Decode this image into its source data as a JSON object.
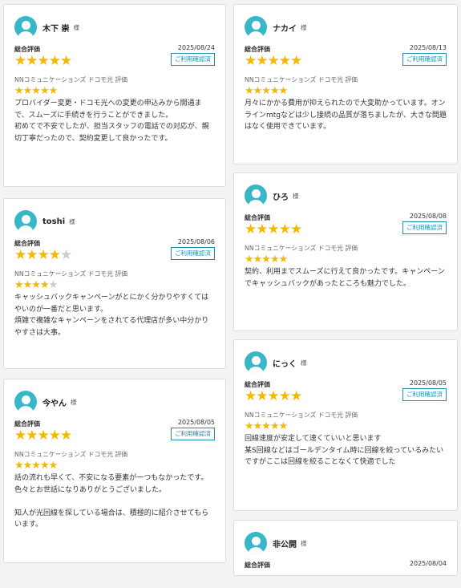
{
  "reviews": [
    {
      "name": "木下 崇",
      "suffix": "様",
      "overall_label": "総合評価",
      "date": "2025/08/24",
      "overall_rating": 5,
      "overall_stars": "★★★★★",
      "overall_stars_off": "",
      "badge": "ご利用確認済",
      "provider_label": "NNコミュニケーションズ ドコモ光 評価",
      "provider_rating": 5,
      "provider_stars": "★★★★★",
      "provider_stars_off": "",
      "comment": "プロバイダー変更・ドコモ光への変更の申込みから開通まで、スムーズに手続きを行うことができました。\n初めてで不安でしたが、担当スタッフの電話での対応が、親切丁寧だったので、契約変更して良かったです。"
    },
    {
      "name": "toshi",
      "suffix": "様",
      "overall_label": "総合評価",
      "date": "2025/08/06",
      "overall_rating": 4,
      "overall_stars": "★★★★",
      "overall_stars_off": "★",
      "badge": "ご利用確認済",
      "provider_label": "NNコミュニケーションズ ドコモ光 評価",
      "provider_rating": 4,
      "provider_stars": "★★★★",
      "provider_stars_off": "★",
      "comment": "キャッシュバックキャンペーンがとにかく分かりやすくてはやいのが一番だと思います。\n煩雑で複雑なキャンペーンをされてる代理店が多い中分かりやすさは大事。"
    },
    {
      "name": "今やん",
      "suffix": "様",
      "overall_label": "総合評価",
      "date": "2025/08/05",
      "overall_rating": 5,
      "overall_stars": "★★★★★",
      "overall_stars_off": "",
      "badge": "ご利用確認済",
      "provider_label": "NNコミュニケーションズ ドコモ光 評価",
      "provider_rating": 5,
      "provider_stars": "★★★★★",
      "provider_stars_off": "",
      "comment": "話の流れも早くて、不安になる要素が一つもなかったです。\n色々とお世話になりありがとうございました。\n\n知人が光回線を探している場合は、積極的に紹介させてもらいます。"
    },
    {
      "name": "ナカイ",
      "suffix": "様",
      "overall_label": "総合評価",
      "date": "2025/08/13",
      "overall_rating": 5,
      "overall_stars": "★★★★★",
      "overall_stars_off": "",
      "badge": "ご利用確認済",
      "provider_label": "NNコミュニケーションズ ドコモ光 評価",
      "provider_rating": 5,
      "provider_stars": "★★★★★",
      "provider_stars_off": "",
      "comment": "月々にかかる費用が抑えられたので大変助かっています。オンラインmtgなどは少し接続の品質が落ちましたが、大きな問題はなく使用できています。"
    },
    {
      "name": "ひろ",
      "suffix": "様",
      "overall_label": "総合評価",
      "date": "2025/08/08",
      "overall_rating": 5,
      "overall_stars": "★★★★★",
      "overall_stars_off": "",
      "badge": "ご利用確認済",
      "provider_label": "NNコミュニケーションズ ドコモ光 評価",
      "provider_rating": 5,
      "provider_stars": "★★★★★",
      "provider_stars_off": "",
      "comment": "契約、利用までスムーズに行えて良かったです。キャンペーンでキャッシュバックがあったところも魅力でした。"
    },
    {
      "name": "にっく",
      "suffix": "様",
      "overall_label": "総合評価",
      "date": "2025/08/05",
      "overall_rating": 5,
      "overall_stars": "★★★★★",
      "overall_stars_off": "",
      "badge": "ご利用確認済",
      "provider_label": "NNコミュニケーションズ ドコモ光 評価",
      "provider_rating": 5,
      "provider_stars": "★★★★★",
      "provider_stars_off": "",
      "comment": "回線速度が安定して速くていいと思います\n某S回線などはゴールデンタイム時に回線を絞っているみたいですがここは回線を絞ることなくて快適でした"
    },
    {
      "name": "非公開",
      "suffix": "様",
      "overall_label": "総合評価",
      "date": "2025/08/04"
    }
  ],
  "colors": {
    "avatar": "#37b7c8",
    "star_on": "#f3b800",
    "star_off": "#cccccc",
    "badge": "#1a8fb0"
  }
}
